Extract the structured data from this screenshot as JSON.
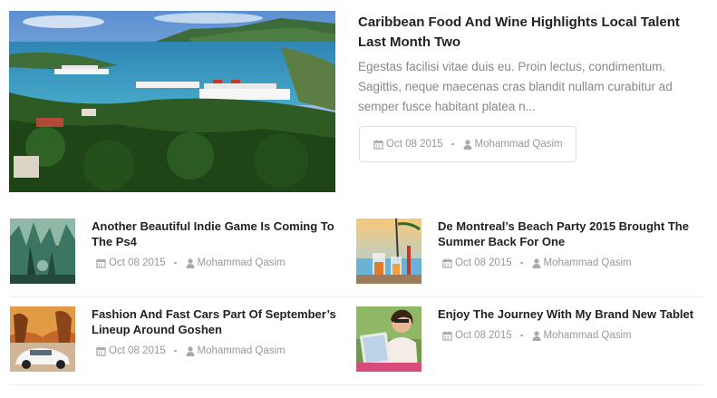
{
  "featured": {
    "title": "Caribbean Food And Wine Highlights Local Talent Last Month Two",
    "excerpt": "Egestas facilisi vitae duis eu. Proin lectus, condimentum. Sagittis, neque maecenas cras blandit nullam curabitur ad semper fusce habitant platea n...",
    "date": "Oct 08 2015",
    "separator": "-",
    "author": "Mohammad Qasim"
  },
  "posts": [
    {
      "title": "Another Beautiful Indie Game Is Coming To The Ps4",
      "date": "Oct 08 2015",
      "separator": "-",
      "author": "Mohammad Qasim"
    },
    {
      "title": "De Montreal’s Beach Party 2015 Brought The Summer Back For One",
      "date": "Oct 08 2015",
      "separator": "-",
      "author": "Mohammad Qasim"
    },
    {
      "title": "Fashion And Fast Cars Part Of September’s Lineup Around Goshen",
      "date": "Oct 08 2015",
      "separator": "-",
      "author": "Mohammad Qasim"
    },
    {
      "title": "Enjoy The Journey With My Brand New Tablet",
      "date": "Oct 08 2015",
      "separator": "-",
      "author": "Mohammad Qasim"
    }
  ],
  "icons": {
    "date": "calendar-icon",
    "author": "user-icon"
  },
  "colors": {
    "title": "#222222",
    "excerpt": "#888888",
    "meta": "#999999",
    "border": "#dcdcdc"
  }
}
